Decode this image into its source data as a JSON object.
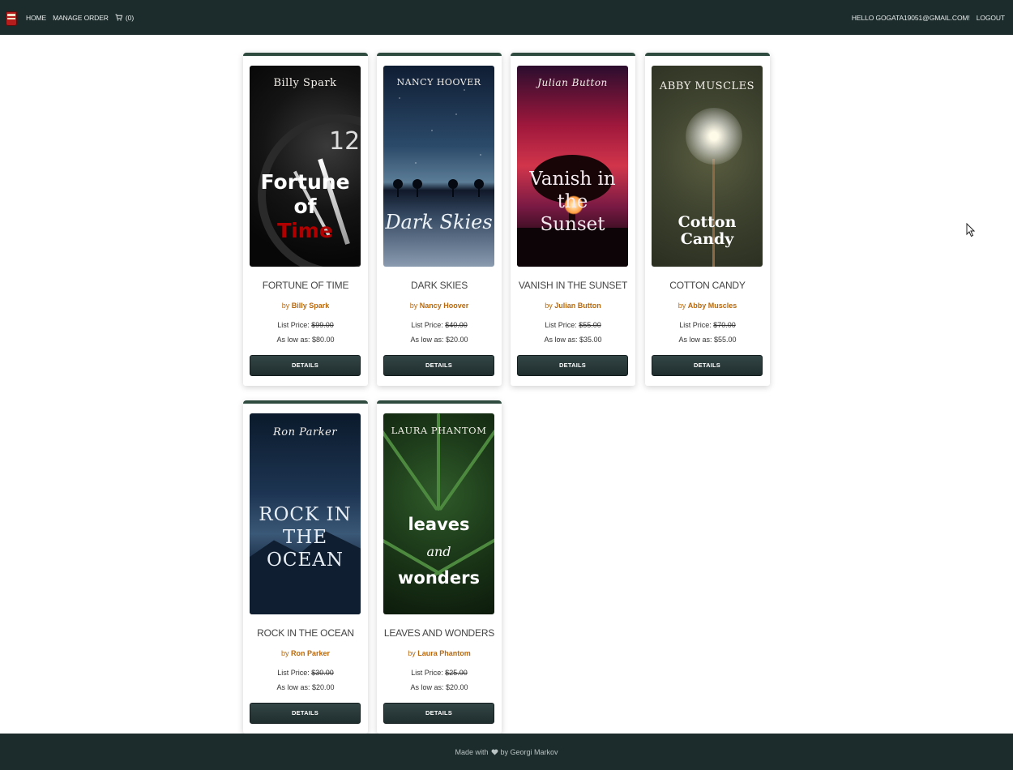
{
  "navbar": {
    "home": "HOME",
    "manage_order": "MANAGE ORDER",
    "cart_count": "(0)",
    "greeting": "HELLO GOGATA19051@GMAIL.COM!",
    "logout": "LOGOUT"
  },
  "labels": {
    "by": "by",
    "list_price": "List Price:",
    "as_low_as": "As low as:",
    "details": "DETAILS"
  },
  "products": [
    {
      "title": "FORTUNE OF TIME",
      "author": "Billy Spark",
      "list_price": "$99.00",
      "low_price": "$80.00",
      "cover_author": "Billy Spark",
      "cover_title": [
        "Fortune",
        "of",
        "Time"
      ]
    },
    {
      "title": "DARK SKIES",
      "author": "Nancy Hoover",
      "list_price": "$40.00",
      "low_price": "$20.00",
      "cover_author": "NANCY HOOVER",
      "cover_title": [
        "Dark Skies"
      ]
    },
    {
      "title": "VANISH IN THE SUNSET",
      "author": "Julian Button",
      "list_price": "$55.00",
      "low_price": "$35.00",
      "cover_author": "Julian Button",
      "cover_title": [
        "Vanish in",
        "the",
        "Sunset"
      ]
    },
    {
      "title": "COTTON CANDY",
      "author": "Abby Muscles",
      "list_price": "$70.00",
      "low_price": "$55.00",
      "cover_author": "ABBY MUSCLES",
      "cover_title": [
        "Cotton Candy"
      ]
    },
    {
      "title": "ROCK IN THE OCEAN",
      "author": "Ron Parker",
      "list_price": "$30.00",
      "low_price": "$20.00",
      "cover_author": "Ron Parker",
      "cover_title": [
        "ROCK IN",
        "THE",
        "OCEAN"
      ]
    },
    {
      "title": "LEAVES AND WONDERS",
      "author": "Laura Phantom",
      "list_price": "$25.00",
      "low_price": "$20.00",
      "cover_author": "LAURA PHANTOM",
      "cover_title": [
        "leaves",
        "and",
        "wonders"
      ]
    }
  ],
  "footer": {
    "made_with": "Made with",
    "by_line": "by Georgi Markov"
  },
  "icons": {
    "brand": "book-logo-icon",
    "cart": "cart-icon",
    "heart": "heart-icon"
  },
  "colors": {
    "navbar_bg": "#1c2b2b",
    "card_top_border": "#2f4a3f",
    "author_accent": "#b8690f",
    "button_bg": "#263737"
  }
}
